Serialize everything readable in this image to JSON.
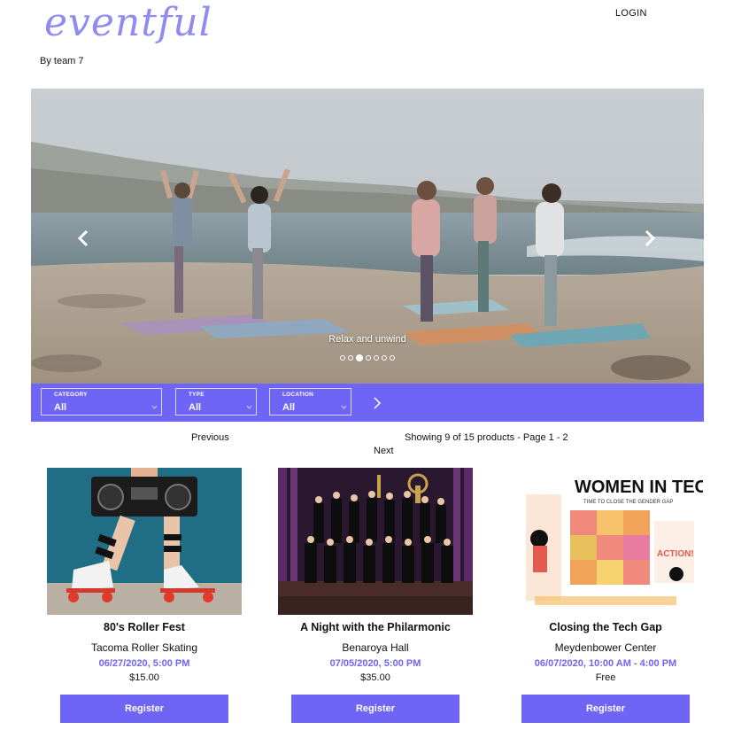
{
  "header": {
    "logo_text": "eventful",
    "byline": "By team 7",
    "login_label": "LOGIN"
  },
  "hero": {
    "caption": "Relax and unwind",
    "slide_count": 7,
    "active_slide": 3
  },
  "filters": {
    "category": {
      "label": "CATEGORY",
      "value": "All"
    },
    "type": {
      "label": "TYPE",
      "value": "All"
    },
    "location": {
      "label": "LOCATION",
      "value": "All"
    }
  },
  "pagination": {
    "previous_label": "Previous",
    "info": "Showing 9 of 15 products - Page 1 - 2",
    "next_label": "Next"
  },
  "events": [
    {
      "title": "80's Roller Fest",
      "venue": "Tacoma Roller Skating",
      "datetime": "06/27/2020, 5:00 PM",
      "price": "$15.00",
      "button": "Register"
    },
    {
      "title": "A Night with the Philarmonic",
      "venue": "Benaroya Hall",
      "datetime": "07/05/2020, 5:00 PM",
      "price": "$35.00",
      "button": "Register"
    },
    {
      "title": "Closing the Tech Gap",
      "venue": "Meydenbower Center",
      "datetime": "06/07/2020, 10:00 AM - 4:00 PM",
      "price": "Free",
      "button": "Register"
    }
  ],
  "images": {
    "women_in_tech_title": "WOMEN IN TECH",
    "women_in_tech_subtitle": "TIME TO CLOSE THE GENDER GAP",
    "women_in_tech_action": "ACTION!"
  },
  "colors": {
    "accent": "#6e64f5",
    "logo": "#8f8bf0"
  }
}
